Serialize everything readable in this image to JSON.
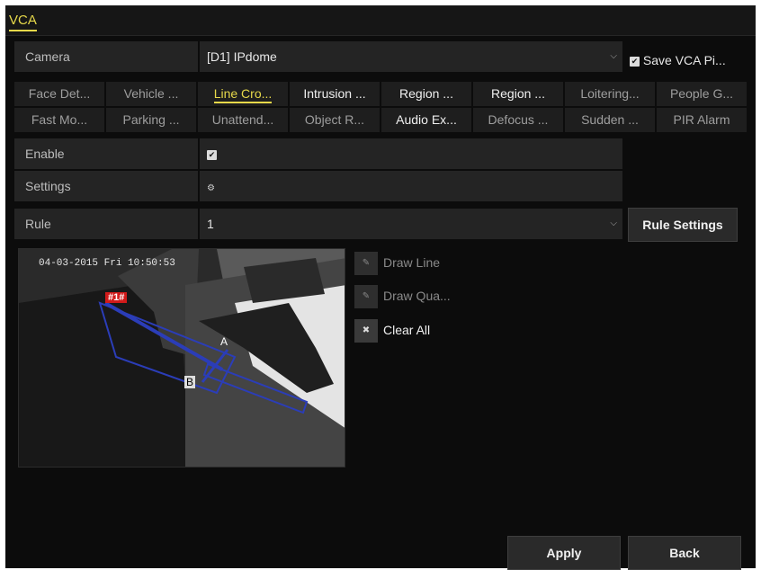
{
  "window": {
    "title": "VCA"
  },
  "camera": {
    "label": "Camera",
    "value": "[D1] IPdome"
  },
  "save_vca": {
    "label": "Save VCA Pi..."
  },
  "tabs": [
    {
      "label": "Face Det...",
      "state": "normal"
    },
    {
      "label": "Vehicle ...",
      "state": "normal"
    },
    {
      "label": "Line Cro...",
      "state": "active"
    },
    {
      "label": "Intrusion ...",
      "state": "bright"
    },
    {
      "label": "Region ...",
      "state": "bright"
    },
    {
      "label": "Region ...",
      "state": "bright"
    },
    {
      "label": "Loitering...",
      "state": "normal"
    },
    {
      "label": "People G...",
      "state": "normal"
    },
    {
      "label": "Fast Mo...",
      "state": "normal"
    },
    {
      "label": "Parking ...",
      "state": "normal"
    },
    {
      "label": "Unattend...",
      "state": "normal"
    },
    {
      "label": "Object R...",
      "state": "normal"
    },
    {
      "label": "Audio Ex...",
      "state": "bright"
    },
    {
      "label": "Defocus ...",
      "state": "normal"
    },
    {
      "label": "Sudden ...",
      "state": "normal"
    },
    {
      "label": "PIR Alarm",
      "state": "normal"
    }
  ],
  "enable": {
    "label": "Enable",
    "checked": true
  },
  "settings": {
    "label": "Settings"
  },
  "rule": {
    "label": "Rule",
    "value": "1",
    "settings_button": "Rule Settings"
  },
  "preview": {
    "timestamp": "04-03-2015 Fri 10:50:53",
    "rule_tag": "#1#",
    "point_a": "A",
    "point_b": "B"
  },
  "tools": {
    "draw_line": "Draw Line",
    "draw_quad": "Draw Qua...",
    "clear_all": "Clear All"
  },
  "footer": {
    "apply": "Apply",
    "back": "Back"
  },
  "colors": {
    "accent": "#e6d84a",
    "background": "#0c0c0c",
    "field": "#242424",
    "rule_line": "#2b3db8",
    "rule_tag": "#d11a1a"
  }
}
